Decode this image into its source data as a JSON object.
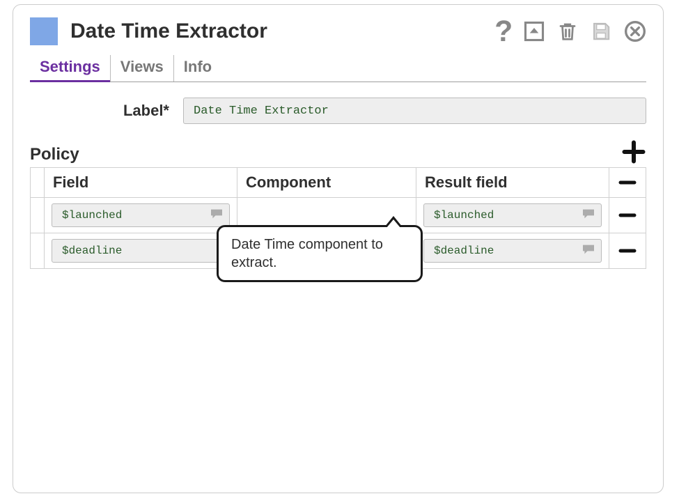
{
  "header": {
    "title": "Date Time Extractor"
  },
  "tabs": {
    "settings": "Settings",
    "views": "Views",
    "info": "Info"
  },
  "form": {
    "label_caption": "Label*",
    "label_value": "Date Time Extractor"
  },
  "policy": {
    "title": "Policy",
    "columns": {
      "field": "Field",
      "component": "Component",
      "result": "Result field"
    },
    "rows": [
      {
        "field": "$launched",
        "component": "",
        "result": "$launched"
      },
      {
        "field": "$deadline",
        "component": "",
        "result": "$deadline"
      }
    ]
  },
  "tooltip": "Date Time component to extract."
}
